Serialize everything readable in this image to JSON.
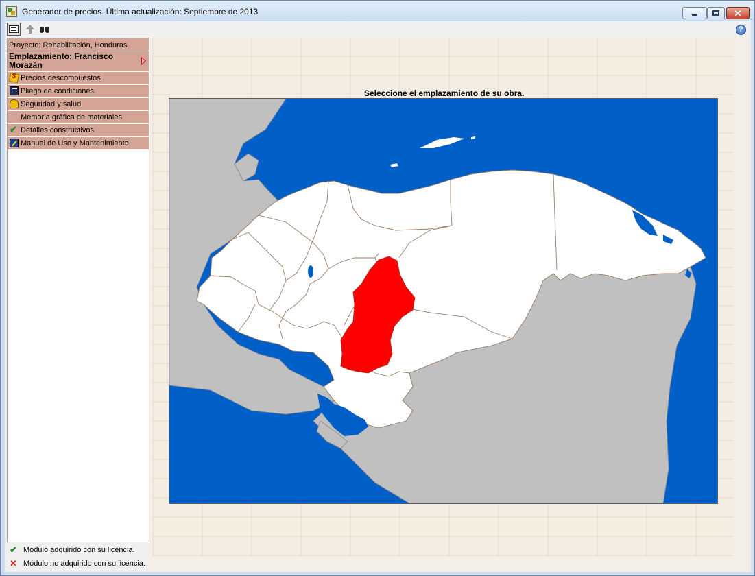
{
  "window": {
    "title": "Generador de precios. Última actualización: Septiembre de 2013",
    "controls": [
      "minimize",
      "maximize",
      "close"
    ]
  },
  "toolbar": {
    "icons": [
      "list-view-icon",
      "up-arrow-icon",
      "binoculars-icon",
      "help-icon"
    ]
  },
  "sidebar": {
    "project": "Proyecto: Rehabilitación, Honduras",
    "location": "Emplazamiento: Francisco Morazán",
    "items": [
      {
        "label": "Precios descompuestos",
        "icon": "prices-icon"
      },
      {
        "label": "Pliego de condiciones",
        "icon": "document-icon"
      },
      {
        "label": "Seguridad y salud",
        "icon": "helmet-icon"
      },
      {
        "label": "Memoria gráfica de materiales",
        "icon": ""
      },
      {
        "label": "Detalles constructivos",
        "icon": "check-icon"
      },
      {
        "label": "Manual de Uso y Mantenimiento",
        "icon": "manual-icon"
      }
    ]
  },
  "legend": {
    "acquired": "Módulo adquirido con su licencia.",
    "not_acquired": "Módulo no adquirido con su licencia."
  },
  "map": {
    "title": "Seleccione el emplazamiento de su obra.",
    "selected_department": "Francisco Morazán",
    "colors": {
      "sea": "#0060c8",
      "neighbors": "#c0c0c0",
      "departments": "#ffffff",
      "selected": "#ff0000",
      "borders": "#9b7a62"
    }
  }
}
